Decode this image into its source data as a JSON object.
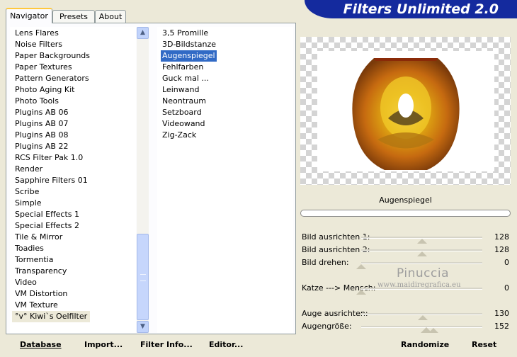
{
  "tabs": [
    "Navigator",
    "Presets",
    "About"
  ],
  "banner_title": "Filters Unlimited 2.0",
  "categories": [
    "Lens Flares",
    "Noise Filters",
    "Paper Backgrounds",
    "Paper Textures",
    "Pattern Generators",
    "Photo Aging Kit",
    "Photo Tools",
    "Plugins AB 06",
    "Plugins AB 07",
    "Plugins AB 08",
    "Plugins AB 22",
    "RCS Filter Pak 1.0",
    "Render",
    "Sapphire Filters 01",
    "Scribe",
    "Simple",
    "Special Effects 1",
    "Special Effects 2",
    "Tile & Mirror",
    "Toadies",
    "Tormentia",
    "Transparency",
    "Video",
    "VM Distortion",
    "VM Texture",
    "°v° Kiwi`s Oelfilter"
  ],
  "selected_category": "°v° Kiwi`s Oelfilter",
  "filters": [
    "3,5 Promille",
    "3D-Bildstanze",
    "Augenspiegel",
    "Fehlfarben",
    "Guck mal ...",
    "Leinwand",
    "Neontraum",
    "Setzboard",
    "Videowand",
    "Zig-Zack"
  ],
  "selected_filter": "Augenspiegel",
  "current_filter_name": "Augenspiegel",
  "params": [
    {
      "label": "Bild ausrichten 1:",
      "value": "128"
    },
    {
      "label": "Bild ausrichten 2:",
      "value": "128"
    },
    {
      "label": "Bild drehen:",
      "value": "0"
    },
    {
      "label": "",
      "value": ""
    },
    {
      "label": "Katze ---> Mensch:",
      "value": "0"
    },
    {
      "label": "",
      "value": ""
    },
    {
      "label": "Auge ausrichten:",
      "value": "130"
    },
    {
      "label": "Augengröße:",
      "value": "152"
    }
  ],
  "watermark": {
    "line1": "Pinuccia",
    "line2": "www.maidiregrafica.eu"
  },
  "buttons": {
    "database": "Database",
    "import": "Import...",
    "filter_info": "Filter Info...",
    "editor": "Editor...",
    "randomize": "Randomize",
    "reset": "Reset"
  },
  "icons": {
    "scroll_up": "chevron-up-icon",
    "scroll_down": "chevron-down-icon"
  },
  "colors": {
    "banner": "#142a9e",
    "selection": "#316ac5",
    "tab_highlight": "#ffc83c"
  }
}
